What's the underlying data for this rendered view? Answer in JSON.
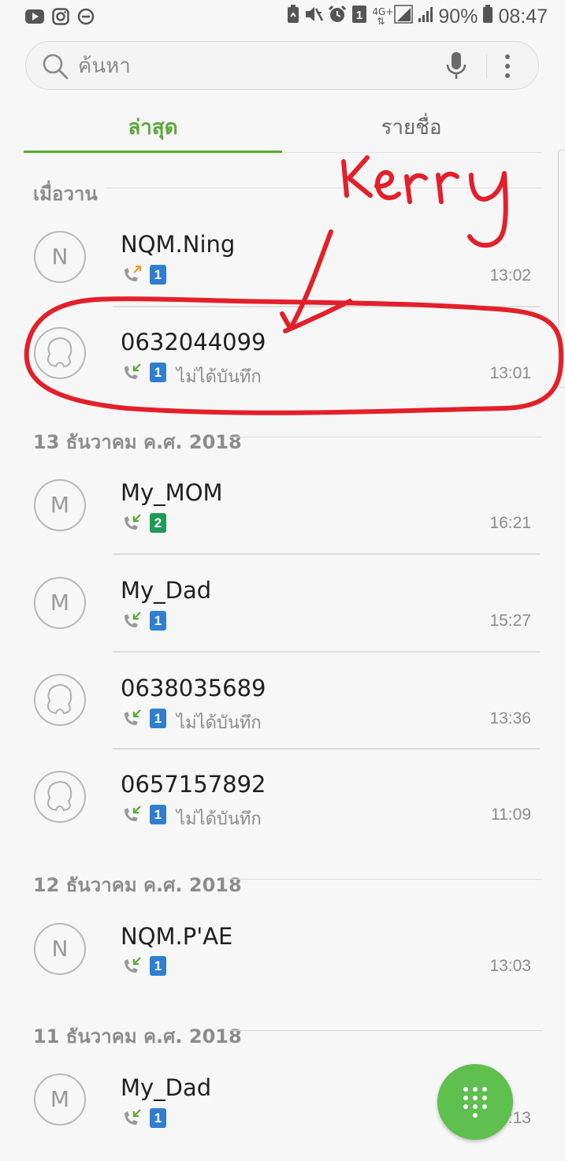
{
  "status_bar": {
    "time": "08:47",
    "battery": "90%",
    "network": "4G+",
    "sim_indicator": "1",
    "left_icons": [
      "youtube-icon",
      "instagram-icon",
      "do-not-disturb-icon"
    ],
    "right_icons": [
      "battery-saver-icon",
      "mute-icon",
      "alarm-icon",
      "sim-1-icon",
      "signal-icon",
      "signal-icon",
      "battery-icon"
    ]
  },
  "search": {
    "placeholder": "ค้นหา"
  },
  "tabs": [
    {
      "label": "ล่าสุด",
      "active": true
    },
    {
      "label": "รายชื่อ",
      "active": false
    }
  ],
  "sections": [
    {
      "header": "เมื่อวาน",
      "calls": [
        {
          "avatar_letter": "N",
          "name": "NQM.Ning",
          "call_type": "outgoing",
          "sim": "1",
          "note": "",
          "time": "13:02"
        },
        {
          "avatar_letter": "",
          "name": "0632044099",
          "call_type": "incoming",
          "sim": "1",
          "note": "ไม่ได้บันทึก",
          "time": "13:01"
        }
      ]
    },
    {
      "header": "13 ธันวาคม ค.ศ. 2018",
      "calls": [
        {
          "avatar_letter": "M",
          "name": "My_MOM",
          "call_type": "incoming",
          "sim": "2",
          "note": "",
          "time": "16:21"
        },
        {
          "avatar_letter": "M",
          "name": "My_Dad",
          "call_type": "incoming",
          "sim": "1",
          "note": "",
          "time": "15:27"
        },
        {
          "avatar_letter": "",
          "name": "0638035689",
          "call_type": "incoming",
          "sim": "1",
          "note": "ไม่ได้บันทึก",
          "time": "13:36"
        },
        {
          "avatar_letter": "",
          "name": "0657157892",
          "call_type": "incoming",
          "sim": "1",
          "note": "ไม่ได้บันทึก",
          "time": "11:09"
        }
      ]
    },
    {
      "header": "12 ธันวาคม ค.ศ. 2018",
      "calls": [
        {
          "avatar_letter": "N",
          "name": "NQM.P'AE",
          "call_type": "incoming",
          "sim": "1",
          "note": "",
          "time": "13:03"
        }
      ]
    },
    {
      "header": "11 ธันวาคม ค.ศ. 2018",
      "calls": [
        {
          "avatar_letter": "M",
          "name": "My_Dad",
          "call_type": "incoming",
          "sim": "1",
          "note": "",
          "time": "13:13"
        }
      ]
    }
  ],
  "annotation": {
    "handwritten_text": "Kerry",
    "color": "#e3202a"
  },
  "colors": {
    "accent": "#5aa937",
    "fab": "#5fbf4f",
    "sim1": "#2f7ed0",
    "sim2": "#1f9a58",
    "outgoing_arrow": "#f39a21",
    "incoming_arrow": "#5aa937"
  }
}
